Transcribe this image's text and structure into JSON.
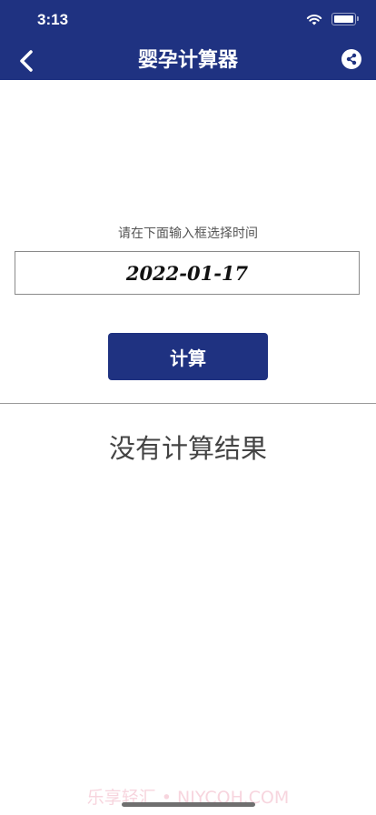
{
  "status_bar": {
    "time": "3:13"
  },
  "header": {
    "title": "婴孕计算器"
  },
  "form": {
    "prompt": "请在下面输入框选择时间",
    "date_value": "2022-01-17",
    "calc_button_label": "计算"
  },
  "result": {
    "text": "没有计算结果"
  },
  "watermark": "乐享轻汇 • NJYCQH.COM",
  "colors": {
    "accent": "#1f3281",
    "background": "#ffffff"
  },
  "icons": {
    "back": "chevron-left-icon",
    "share": "share-icon",
    "wifi": "wifi-icon",
    "battery": "battery-icon"
  }
}
